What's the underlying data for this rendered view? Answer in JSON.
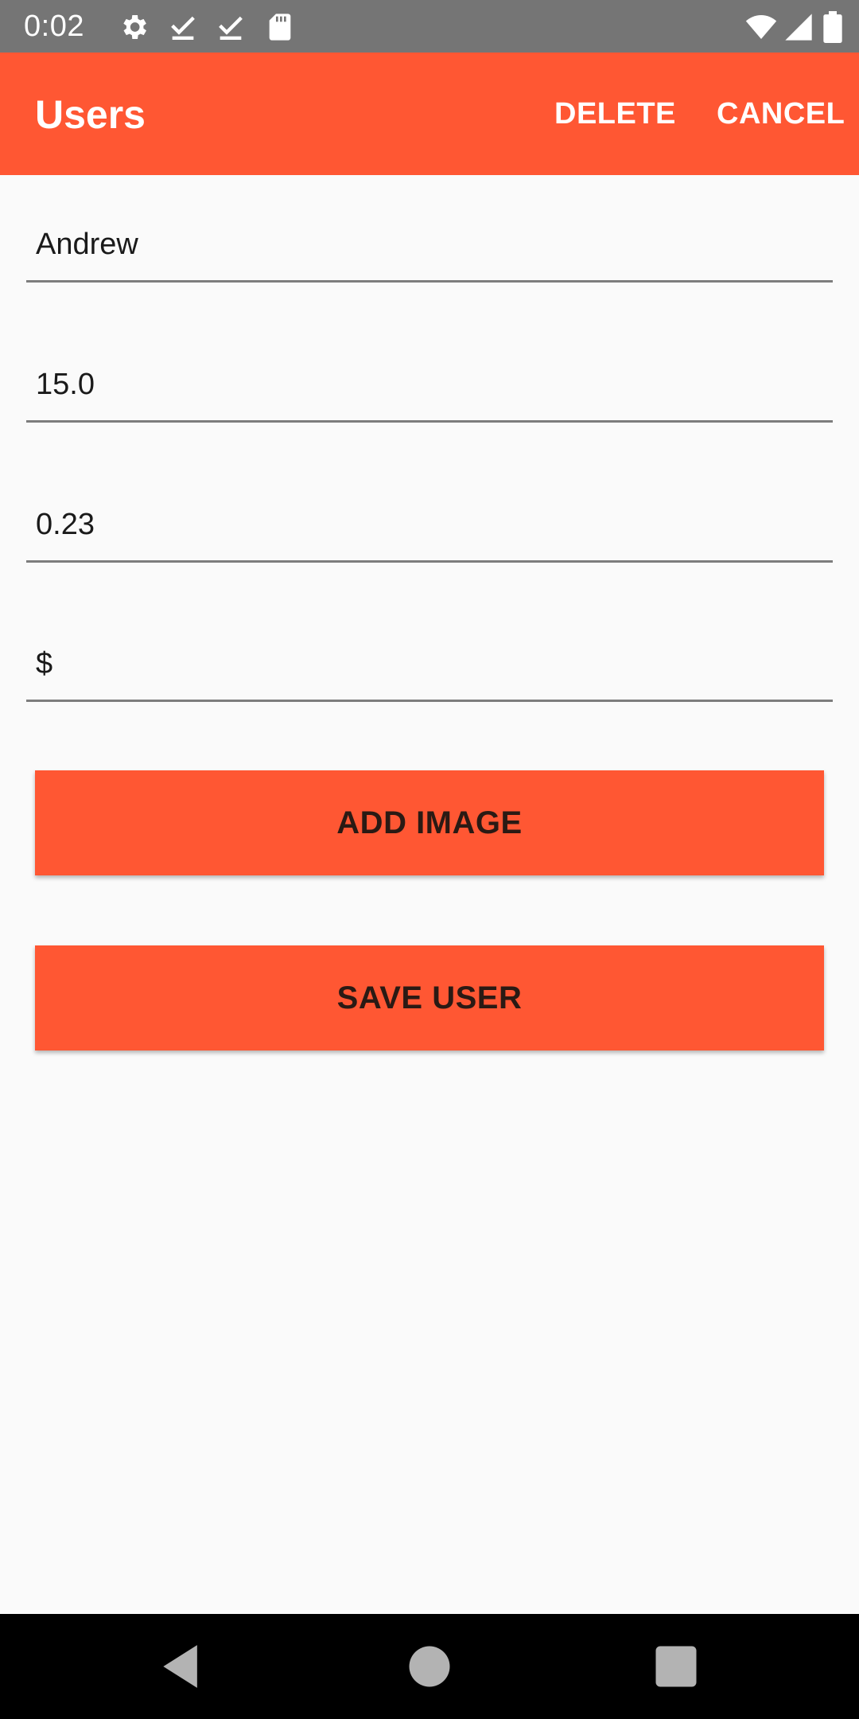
{
  "status_bar": {
    "time": "0:02",
    "icons": [
      "settings-icon",
      "checkmark-download-icon",
      "checkmark-download-icon",
      "sd-card-icon",
      "wifi-icon",
      "cell-signal-icon",
      "battery-icon"
    ]
  },
  "app_bar": {
    "title": "Users",
    "actions": {
      "delete": "DELETE",
      "cancel": "CANCEL"
    }
  },
  "form": {
    "fields": [
      {
        "value": "Andrew"
      },
      {
        "value": "15.0"
      },
      {
        "value": "0.23"
      },
      {
        "value": "$"
      }
    ]
  },
  "buttons": {
    "add_image": "ADD IMAGE",
    "save_user": "SAVE USER"
  },
  "nav_bar": {
    "buttons": [
      "back-icon",
      "home-icon",
      "recents-icon"
    ]
  },
  "colors": {
    "accent": "#ff5733",
    "status_bar": "#757575",
    "background": "#fafafa",
    "nav_bar": "#000000"
  }
}
